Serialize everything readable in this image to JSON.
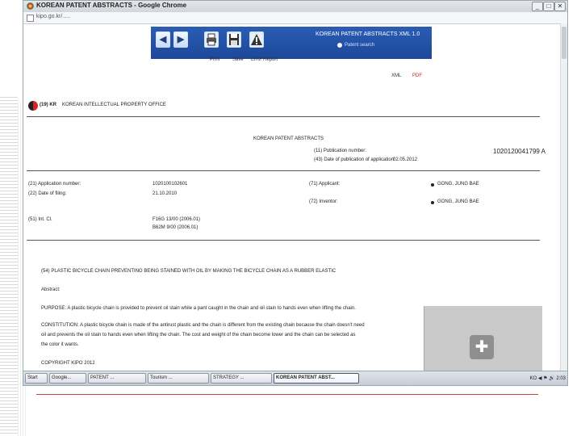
{
  "window": {
    "title": "KOREAN PATENT ABSTRACTS - Google Chrome",
    "min": "_",
    "max": "□",
    "close": "✕",
    "url": "kipo.go.kr/....."
  },
  "toolbar": {
    "title": "KOREAN PATENT ABSTRACTS XML 1.0",
    "subtitle": "Patent search",
    "print_label": "Print",
    "save_label": "Save",
    "error_report_label": "Error Report",
    "back_glyph": "◀",
    "forward_glyph": "▶"
  },
  "formats": [
    "XML",
    "PDF"
  ],
  "office": {
    "code": "(19) KR",
    "name": "KOREAN INTELLECTUAL PROPERTY OFFICE"
  },
  "document": {
    "heading": "KOREAN PATENT ABSTRACTS",
    "publication_number_label": "(11) Publication number:",
    "publication_number": "1020120041799 A",
    "publication_date_label": "(43) Date of publication of application:",
    "publication_date": "02.05.2012",
    "application_number_label": "(21) Application number:",
    "application_number": "1020100102601",
    "applicant_label": "(71) Applicant:",
    "applicant": "GONG, JUNG BAE",
    "application_date_label": "(22) Date of filing:",
    "application_date": "21.10.2010",
    "inventor_label": "(72) Inventor:",
    "inventor": "GONG, JUNG BAE",
    "ipc_label": "(51) Int. Cl.",
    "ipc_lines": [
      "F16G 13/00 (2006.01)",
      "B62M 9/00 (2006.01)"
    ],
    "title_line": "(54) PLASTIC BICYCLE CHAIN PREVENTING BEING STAINED WITH OIL BY MAKING THE BICYCLE CHAIN AS A RUBBER ELASTIC",
    "abstract_heading": "Abstract:",
    "purpose": "PURPOSE: A plastic bicycle chain is provided to prevent oil stain while a pant caught in the chain and oil stain to hands even when lifting the chain.",
    "constitution_1": "CONSTITUTION: A plastic bicycle chain is made of the antirust plastic and the chain is different from the existing chain because the chain doesn't need",
    "constitution_2": "oil and prevents the oil stain to hands even when lifting the chain. The cost and weight of the chain become lower and the chain can be selected as",
    "constitution_3": "the color it wants.",
    "copyright": "COPYRIGHT KIPO 2012"
  },
  "taskbar": {
    "items": [
      "Start",
      "Google...",
      "PATENT ...",
      "Tourism ...",
      "STRATEGY ...",
      "KOREAN PATENT ABST..."
    ],
    "tray": "KO  ◀ ⚑ 🔊  2:03"
  }
}
